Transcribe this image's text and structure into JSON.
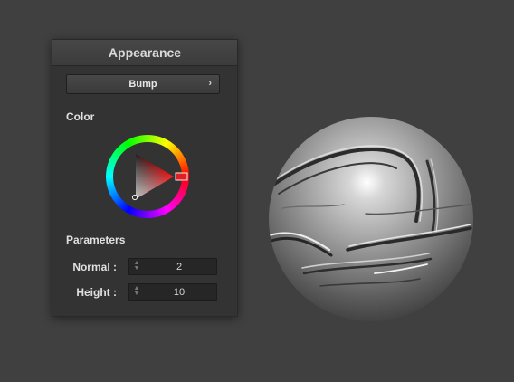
{
  "panel": {
    "title": "Appearance",
    "dropdown": {
      "selected": "Bump",
      "chevron": "›"
    },
    "color_section": {
      "title": "Color",
      "hue_color": "#ff2020"
    },
    "parameters_section": {
      "title": "Parameters",
      "rows": [
        {
          "label": "Normal :",
          "value": "2"
        },
        {
          "label": "Height :",
          "value": "10"
        }
      ]
    }
  },
  "viewport": {
    "object": "bump-sphere"
  },
  "colors": {
    "background": "#404040",
    "panel": "#333333",
    "accent": "#ff2020"
  }
}
